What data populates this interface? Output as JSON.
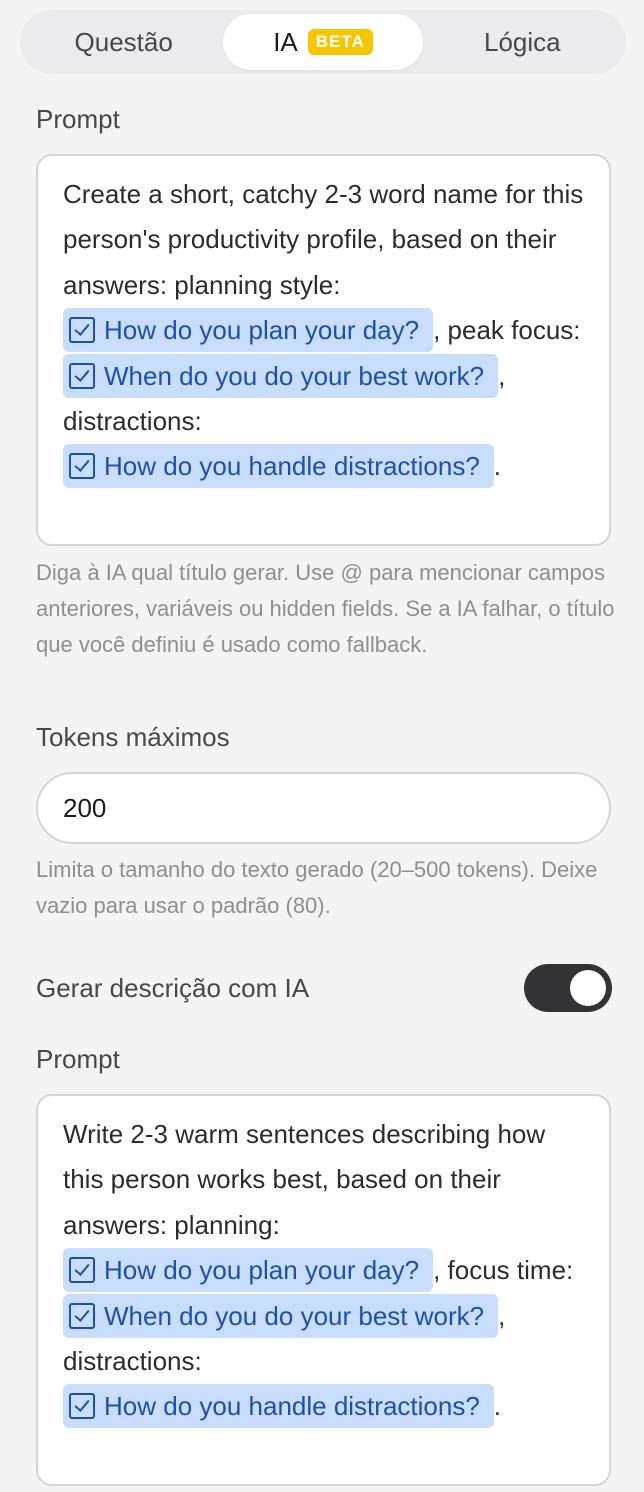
{
  "tabs": [
    {
      "label": "Questão"
    },
    {
      "label": "IA",
      "badge": "BETA"
    },
    {
      "label": "Lógica"
    }
  ],
  "title_prompt": {
    "label": "Prompt",
    "t1": "Create a short, catchy 2-3 word name for this person's productivity profile, based on their answers: planning style: ",
    "m1": "How do you plan your day?",
    "t2": ", peak focus: ",
    "m2": "When do you do your best work?",
    "t3": ", distractions: ",
    "m3": "How do you handle distractions?",
    "t4": ".",
    "help": "Diga à IA qual título gerar. Use @ para mencionar campos anteriores, variáveis ou hidden fields. Se a IA falhar, o título que você definiu é usado como fallback."
  },
  "max_tokens": {
    "label": "Tokens máximos",
    "value": "200",
    "help": "Limita o tamanho do texto gerado (20–500 tokens). Deixe vazio para usar o padrão (80)."
  },
  "description_toggle": {
    "label": "Gerar descrição com IA",
    "enabled": true
  },
  "description_prompt": {
    "label": "Prompt",
    "t1": "Write 2-3 warm sentences describing how this person works best, based on their answers: planning: ",
    "m1": "How do you plan your day?",
    "t2": ", focus time: ",
    "m2": "When do you do your best work?",
    "t3": ", distractions: ",
    "m3": "How do you handle distractions?",
    "t4": "."
  },
  "colors": {
    "accent_badge": "#f7c600",
    "mention_bg": "#c9defc",
    "mention_text": "#1d4fb0",
    "toggle_on": "#333335"
  }
}
